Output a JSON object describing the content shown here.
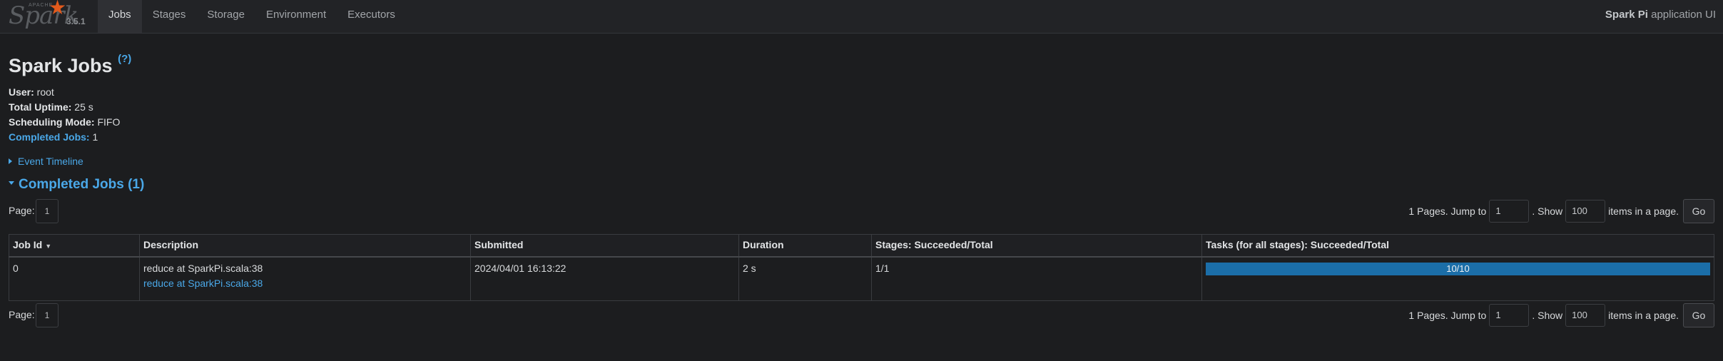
{
  "navbar": {
    "logo_text": "Spark",
    "logo_apache": "APACHE",
    "version": "3.5.1",
    "tabs": [
      {
        "label": "Jobs",
        "active": true
      },
      {
        "label": "Stages"
      },
      {
        "label": "Storage"
      },
      {
        "label": "Environment"
      },
      {
        "label": "Executors"
      }
    ],
    "app_name": "Spark Pi",
    "app_suffix": " application UI"
  },
  "header": {
    "title": "Spark Jobs",
    "help": "(?)"
  },
  "summary": {
    "user_label": "User:",
    "user_value": " root",
    "uptime_label": "Total Uptime:",
    "uptime_value": " 25 s",
    "mode_label": "Scheduling Mode:",
    "mode_value": " FIFO",
    "completed_label": "Completed Jobs:",
    "completed_value": " 1"
  },
  "event_timeline": "Event Timeline",
  "completed_section": "Completed Jobs (1)",
  "pagination": {
    "page_label": "Page:",
    "current_page": "1",
    "pages_text": "1 Pages. Jump to",
    "jump_value": "1",
    "show_text": ". Show",
    "show_value": "100",
    "items_text": "items in a page.",
    "go_label": "Go"
  },
  "table": {
    "headers": [
      "Job Id",
      "Description",
      "Submitted",
      "Duration",
      "Stages: Succeeded/Total",
      "Tasks (for all stages): Succeeded/Total"
    ],
    "rows": [
      {
        "job_id": "0",
        "description": "reduce at SparkPi.scala:38",
        "description_link": "reduce at SparkPi.scala:38",
        "submitted": "2024/04/01 16:13:22",
        "duration": "2 s",
        "stages": "1/1",
        "tasks": "10/10",
        "tasks_fraction": 1.0
      }
    ]
  },
  "colors": {
    "background": "#1c1d1f",
    "link": "#4aa8e8",
    "progress_bar": "#1b6ea8",
    "spark_star": "#e25a1c"
  }
}
